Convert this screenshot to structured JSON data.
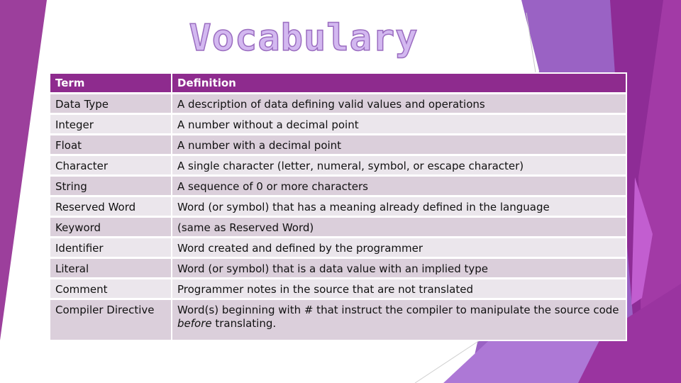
{
  "slide": {
    "title": "Vocabulary",
    "colors": {
      "header_bg": "#8e2b8e",
      "row_odd": "#dbcfdb",
      "row_even": "#ebe6ec",
      "title_fill": "#d3b8f0",
      "accent_purple": "#9c3aa0",
      "accent_lavender": "#9a62c4"
    }
  },
  "table": {
    "headers": [
      "Term",
      "Definition"
    ],
    "rows": [
      {
        "term": "Data Type",
        "definition": "A description of data defining valid values and operations"
      },
      {
        "term": "Integer",
        "definition": "A number without a decimal point"
      },
      {
        "term": "Float",
        "definition": "A number with a decimal point"
      },
      {
        "term": "Character",
        "definition": "A single character (letter, numeral, symbol, or escape character)"
      },
      {
        "term": "String",
        "definition": "A sequence of 0 or more characters"
      },
      {
        "term": "Reserved Word",
        "definition": "Word (or symbol) that has a meaning already defined in the language"
      },
      {
        "term": "Keyword",
        "definition": "(same as Reserved Word)"
      },
      {
        "term": "Identifier",
        "definition": "Word created and defined by the programmer"
      },
      {
        "term": "Literal",
        "definition": "Word (or symbol) that is a data value with an implied type"
      },
      {
        "term": "Comment",
        "definition": "Programmer notes in the source that are not translated"
      },
      {
        "term": "Compiler Directive",
        "definition_parts": {
          "pre": "Word(s) beginning with # that instruct the compiler to manipulate the source code ",
          "em": "before",
          "post": " translating."
        }
      }
    ]
  }
}
